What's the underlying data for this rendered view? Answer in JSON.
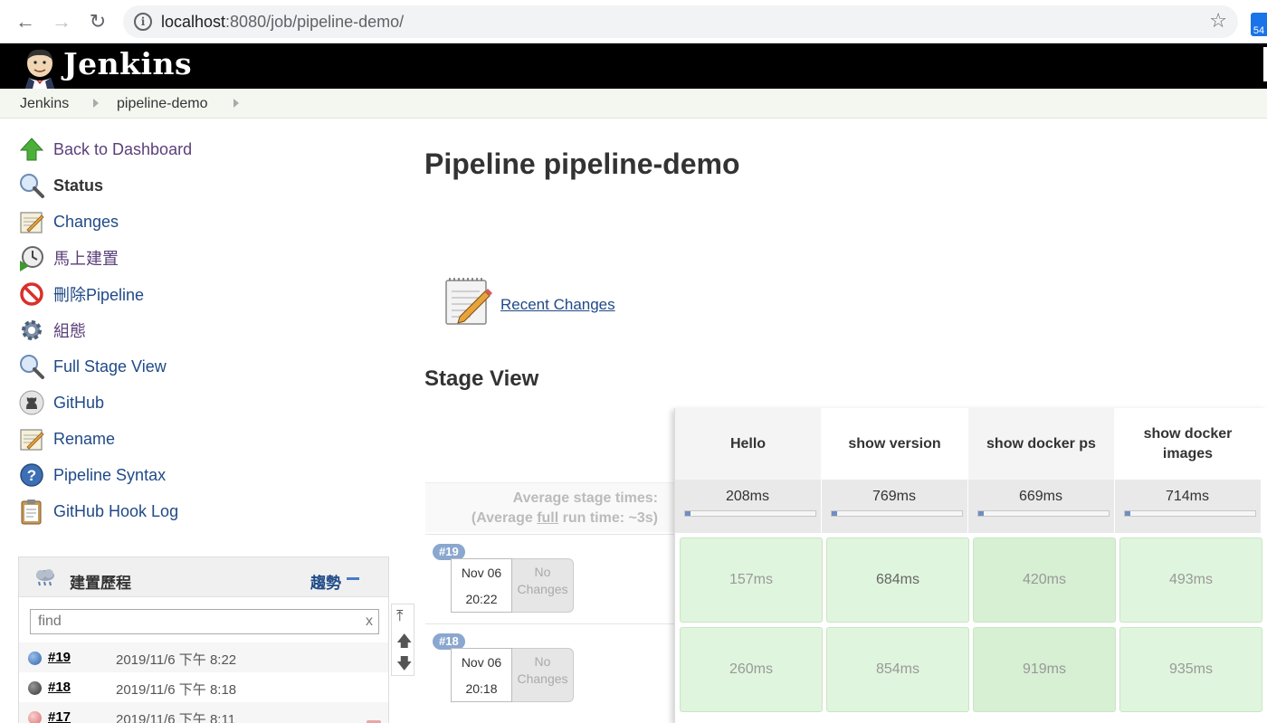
{
  "browser": {
    "url_host": "localhost",
    "url_path": ":8080/job/pipeline-demo/",
    "ext_badge": "54"
  },
  "header": {
    "title": "Jenkins"
  },
  "breadcrumb": {
    "items": [
      "Jenkins",
      "pipeline-demo"
    ]
  },
  "sidebar": {
    "items": [
      {
        "label": "Back to Dashboard",
        "icon": "up-arrow-icon"
      },
      {
        "label": "Status",
        "icon": "magnifier-icon"
      },
      {
        "label": "Changes",
        "icon": "notepad-icon"
      },
      {
        "label": "馬上建置",
        "icon": "clock-play-icon"
      },
      {
        "label": "刪除Pipeline",
        "icon": "no-entry-icon"
      },
      {
        "label": "組態",
        "icon": "gear-icon"
      },
      {
        "label": "Full Stage View",
        "icon": "magnifier-icon"
      },
      {
        "label": "GitHub",
        "icon": "github-icon"
      },
      {
        "label": "Rename",
        "icon": "notepad-icon"
      },
      {
        "label": "Pipeline Syntax",
        "icon": "help-icon"
      },
      {
        "label": "GitHub Hook Log",
        "icon": "clipboard-icon"
      }
    ]
  },
  "build_history": {
    "title": "建置歷程",
    "trend_label": "趨勢",
    "search_placeholder": "find",
    "clear_label": "x",
    "builds": [
      {
        "number": "#19",
        "date": "2019/11/6 下午 8:22",
        "status_color": "#4a7fc1"
      },
      {
        "number": "#18",
        "date": "2019/11/6 下午 8:18",
        "status_color": "#555555"
      },
      {
        "number": "#17",
        "date": "2019/11/6 下午 8:11",
        "status_color": "#e9a0a0"
      }
    ]
  },
  "main": {
    "title": "Pipeline pipeline-demo",
    "recent_changes": "Recent Changes",
    "stage_view_title": "Stage View"
  },
  "stage_view": {
    "avg_label_line1": "Average stage times:",
    "avg_label_pre": "(Average ",
    "avg_label_full": "full",
    "avg_label_post": " run time: ~3s)",
    "stages": [
      {
        "name": "Hello",
        "avg": "208ms",
        "avg_fill": 0.04
      },
      {
        "name": "show version",
        "avg": "769ms",
        "avg_fill": 0.04
      },
      {
        "name": "show docker ps",
        "avg": "669ms",
        "avg_fill": 0.04
      },
      {
        "name": "show docker images",
        "avg": "714ms",
        "avg_fill": 0.04
      }
    ],
    "runs": [
      {
        "badge": "#19",
        "date": "Nov 06",
        "time": "20:22",
        "changes": "No Changes",
        "durations": [
          "157ms",
          "684ms",
          "420ms",
          "493ms"
        ]
      },
      {
        "badge": "#18",
        "date": "Nov 06",
        "time": "20:18",
        "changes": "No Changes",
        "durations": [
          "260ms",
          "854ms",
          "919ms",
          "935ms"
        ]
      }
    ]
  }
}
